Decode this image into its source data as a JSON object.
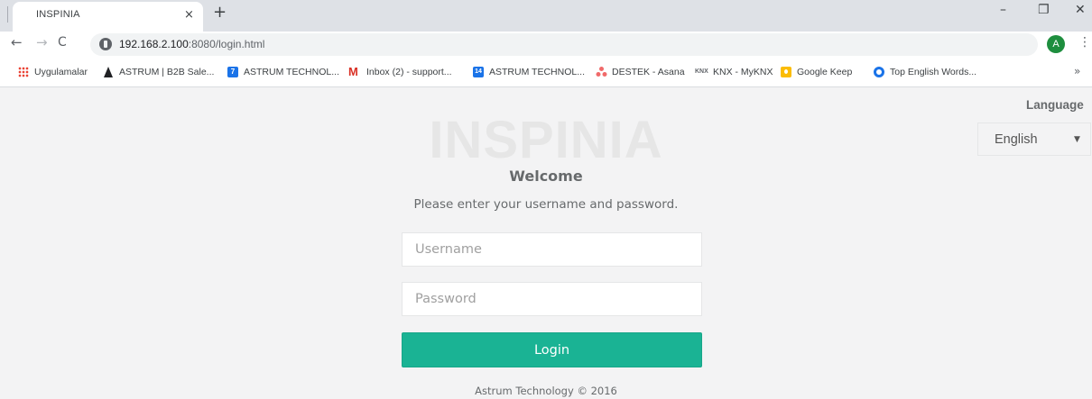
{
  "browser": {
    "tab_title": "INSPINIA",
    "tab_close": "×",
    "new_tab": "+",
    "window_min": "–",
    "window_max": "❐",
    "window_close": "✕",
    "nav_back": "←",
    "nav_forward": "→",
    "nav_reload": "C",
    "url_host": "192.168.2.100",
    "url_rest": ":8080/login.html",
    "avatar_letter": "A",
    "menu_icon": "⋮",
    "bookmarks_more": "»"
  },
  "bookmarks": [
    {
      "label": "Uygulamalar",
      "icon": "apps-grid-icon"
    },
    {
      "label": "ASTRUM | B2B Sale...",
      "icon": "astrum-logo-icon"
    },
    {
      "label": "ASTRUM TECHNOL...",
      "icon": "calendar-7-icon",
      "icon_text": "7"
    },
    {
      "label": "Inbox (2) - support...",
      "icon": "gmail-icon",
      "icon_text": "M"
    },
    {
      "label": "ASTRUM TECHNOL...",
      "icon": "calendar-14-icon",
      "icon_text": "14"
    },
    {
      "label": "DESTEK - Asana",
      "icon": "asana-icon"
    },
    {
      "label": "KNX - MyKNX",
      "icon": "knx-icon",
      "icon_text": "KNX"
    },
    {
      "label": "Google Keep",
      "icon": "google-keep-icon"
    },
    {
      "label": "Top English Words...",
      "icon": "top-english-icon"
    }
  ],
  "page": {
    "language_label": "Language",
    "language_selected": "English",
    "language_caret": "▼",
    "logo_text": "INSPINIA",
    "welcome": "Welcome",
    "subtitle": "Please enter your username and password.",
    "username_placeholder": "Username",
    "password_placeholder": "Password",
    "login_label": "Login",
    "footer": "Astrum Technology © 2016"
  },
  "colors": {
    "accent": "#1ab394",
    "background": "#f3f3f4",
    "text": "#676a6c"
  }
}
